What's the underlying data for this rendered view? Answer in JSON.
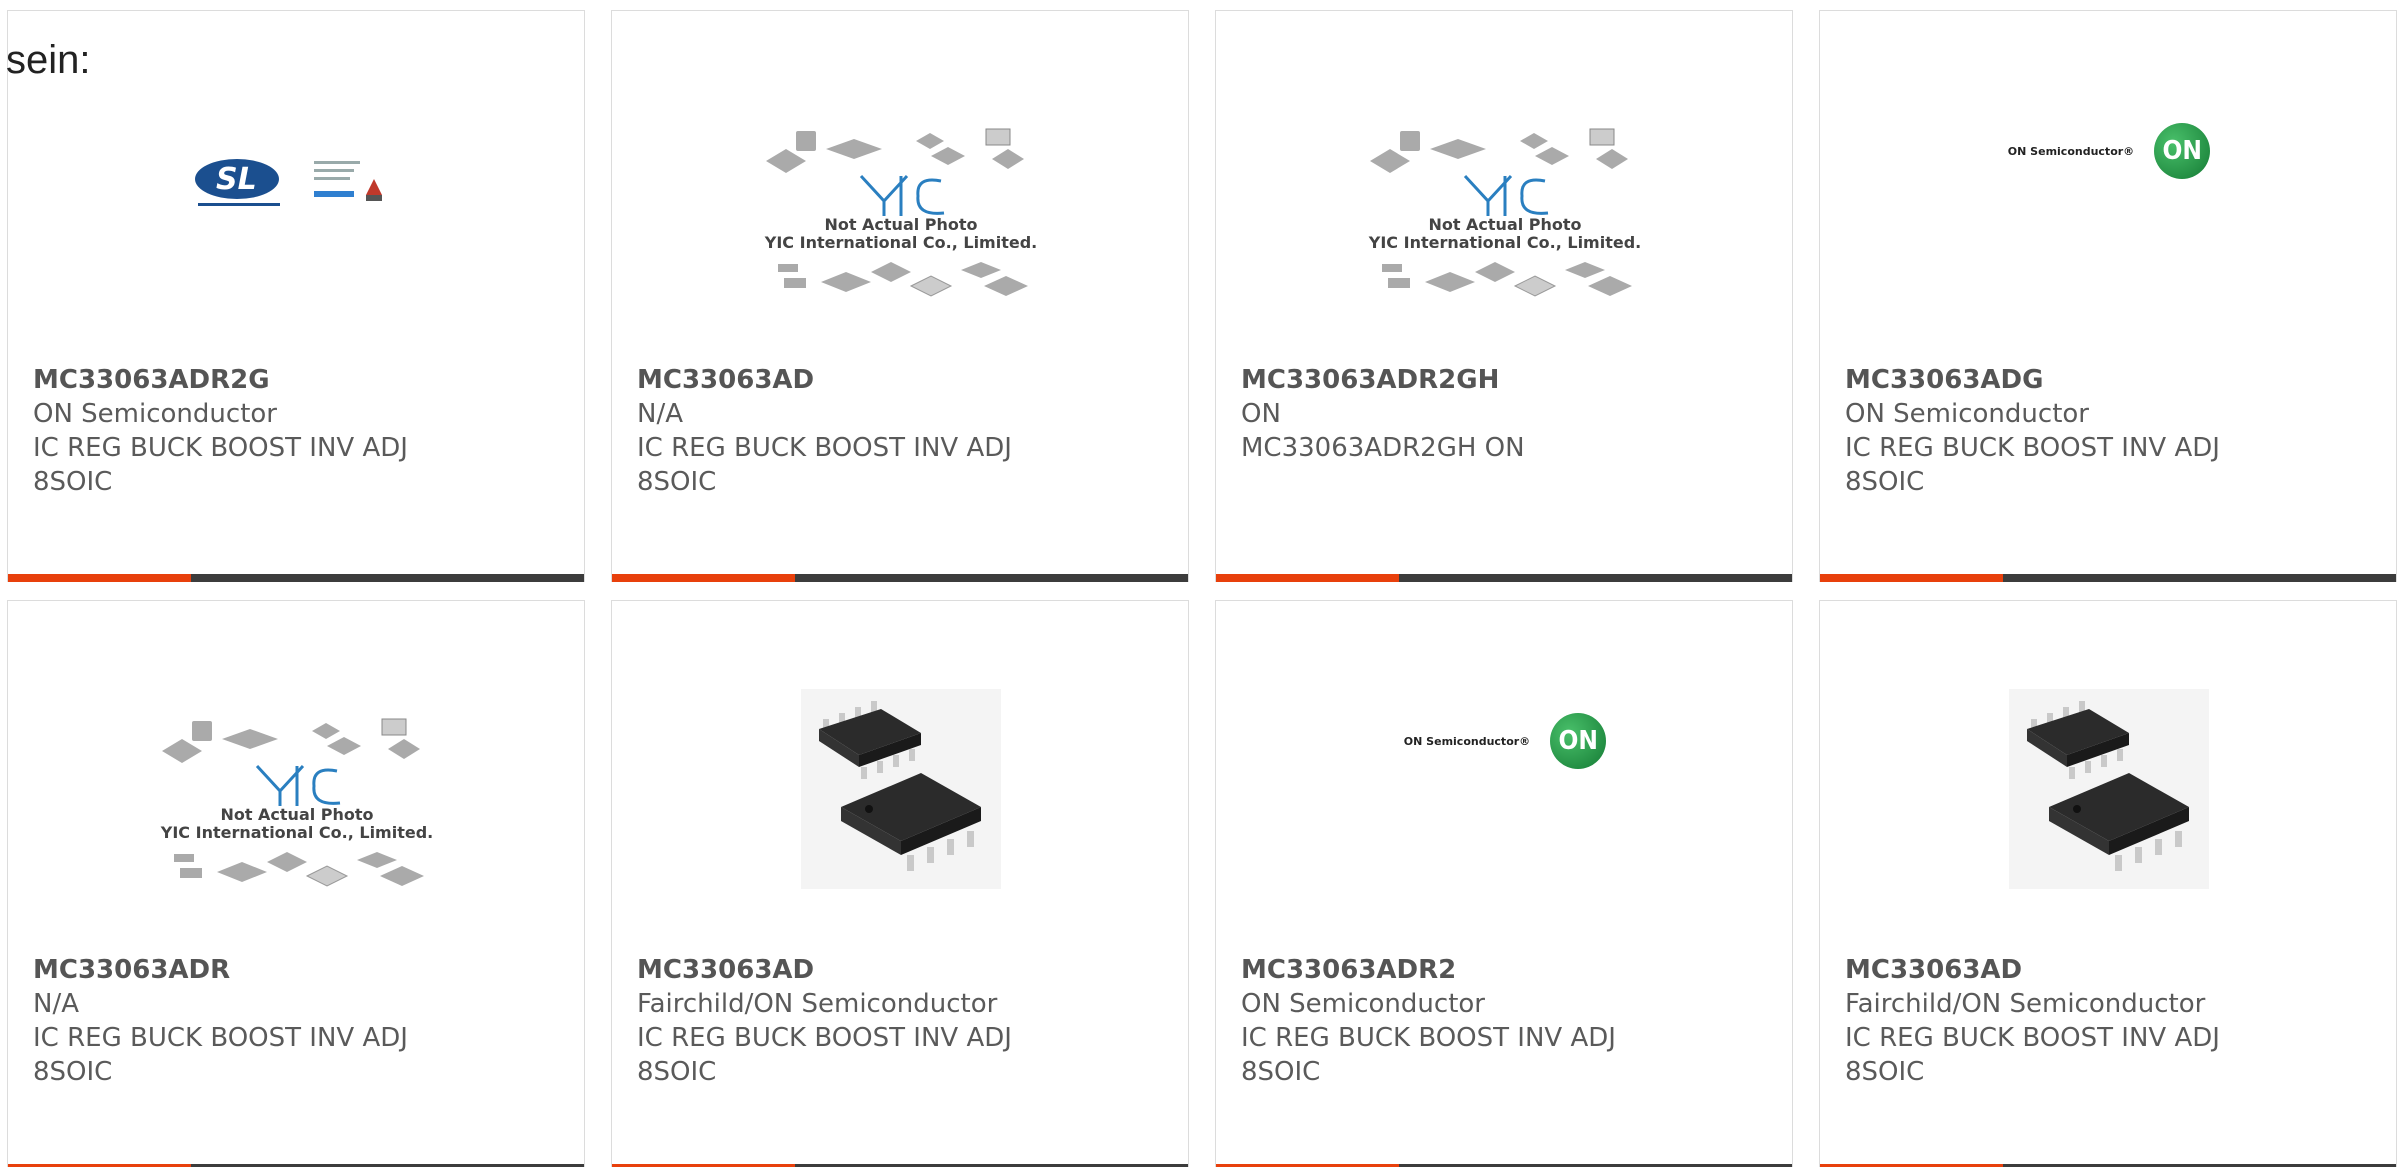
{
  "page": {
    "title": "sein:"
  },
  "colors": {
    "accent": "#e8400c",
    "bar_dark": "#3c3c3c",
    "text": "#5a5a5a"
  },
  "placeholder": {
    "line1": "Not Actual Photo",
    "line2": "YIC International Co., Limited."
  },
  "products": [
    {
      "part": "MC33063ADR2G",
      "manufacturer": "ON Semiconductor",
      "description": "IC REG BUCK BOOST INV ADJ 8SOIC",
      "image": "sl-power-logo"
    },
    {
      "part": "MC33063AD",
      "manufacturer": "N/A",
      "description": "IC REG BUCK BOOST INV ADJ 8SOIC",
      "image": "yic-placeholder"
    },
    {
      "part": "MC33063ADR2GH",
      "manufacturer": "ON",
      "description": "MC33063ADR2GH ON",
      "image": "yic-placeholder"
    },
    {
      "part": "MC33063ADG",
      "manufacturer": "ON Semiconductor",
      "description": "IC REG BUCK BOOST INV ADJ 8SOIC",
      "image": "on-semi-logo"
    },
    {
      "part": "MC33063ADR",
      "manufacturer": "N/A",
      "description": "IC REG BUCK BOOST INV ADJ 8SOIC",
      "image": "yic-placeholder"
    },
    {
      "part": "MC33063AD",
      "manufacturer": "Fairchild/ON Semiconductor",
      "description": "IC REG BUCK BOOST INV ADJ 8SOIC",
      "image": "soic-chip"
    },
    {
      "part": "MC33063ADR2",
      "manufacturer": "ON Semiconductor",
      "description": "IC REG BUCK BOOST INV ADJ 8SOIC",
      "image": "on-semi-logo"
    },
    {
      "part": "MC33063AD",
      "manufacturer": "Fairchild/ON Semiconductor",
      "description": "IC REG BUCK BOOST INV ADJ 8SOIC",
      "image": "soic-chip"
    }
  ]
}
